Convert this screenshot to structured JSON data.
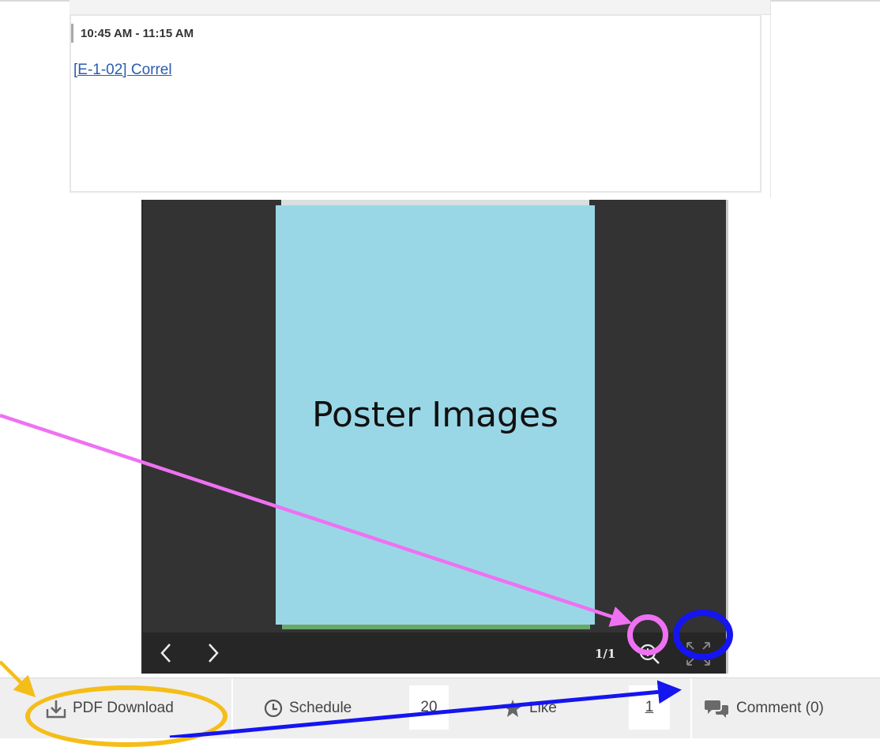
{
  "schedule": {
    "time_range": "10:45 AM - 11:15 AM",
    "session_link": "[E-1-02] Correl"
  },
  "viewer": {
    "poster_label": "Poster Images",
    "poster_color": "#9ad7e6",
    "page_indicator": "1/1",
    "prev_icon": "chevron-left-icon",
    "next_icon": "chevron-right-icon",
    "zoom_icon": "zoom-in-icon",
    "fullscreen_icon": "fullscreen-icon"
  },
  "actions": {
    "pdf_download": "PDF Download",
    "schedule": "Schedule",
    "schedule_count": "20",
    "like": "Like",
    "like_count": "1",
    "comment": "Comment (0)"
  },
  "annotations": {
    "zoom_highlight_color": "#ef71f2",
    "fullscreen_highlight_color": "#1515f0",
    "pdf_highlight_color": "#f5bd18"
  }
}
